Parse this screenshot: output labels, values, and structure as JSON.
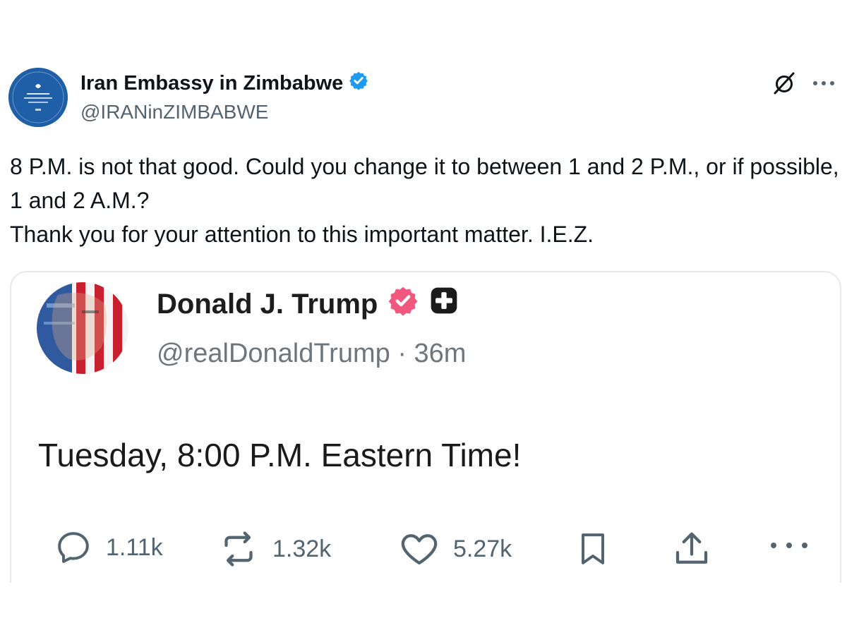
{
  "post": {
    "author": {
      "name": "Iran Embassy in Zimbabwe",
      "handle": "@IRANinZIMBABWE",
      "verified_color": "#1d9bf0"
    },
    "actions": {
      "grok_icon": "grok-slash-circle-icon",
      "more_icon": "more-dots-icon"
    },
    "text": {
      "line1": "8 P.M. is not that good. Could you change it to between 1 and 2 P.M., or if possible, 1 and 2 A.M.?",
      "line2": "Thank you for your attention to this important matter. I.E.Z."
    }
  },
  "quoted": {
    "author": {
      "name": "Donald J. Trump",
      "handle": "@realDonaldTrump",
      "separator": "·",
      "time": "36m",
      "badge_color": "#f0587d"
    },
    "text": "Tuesday, 8:00 P.M. Eastern Time!",
    "stats": {
      "replies": "1.11k",
      "reposts": "1.32k",
      "likes": "5.27k"
    }
  },
  "colors": {
    "text_primary": "#0f1419",
    "text_secondary": "#536471",
    "border": "#e6e9ec"
  }
}
